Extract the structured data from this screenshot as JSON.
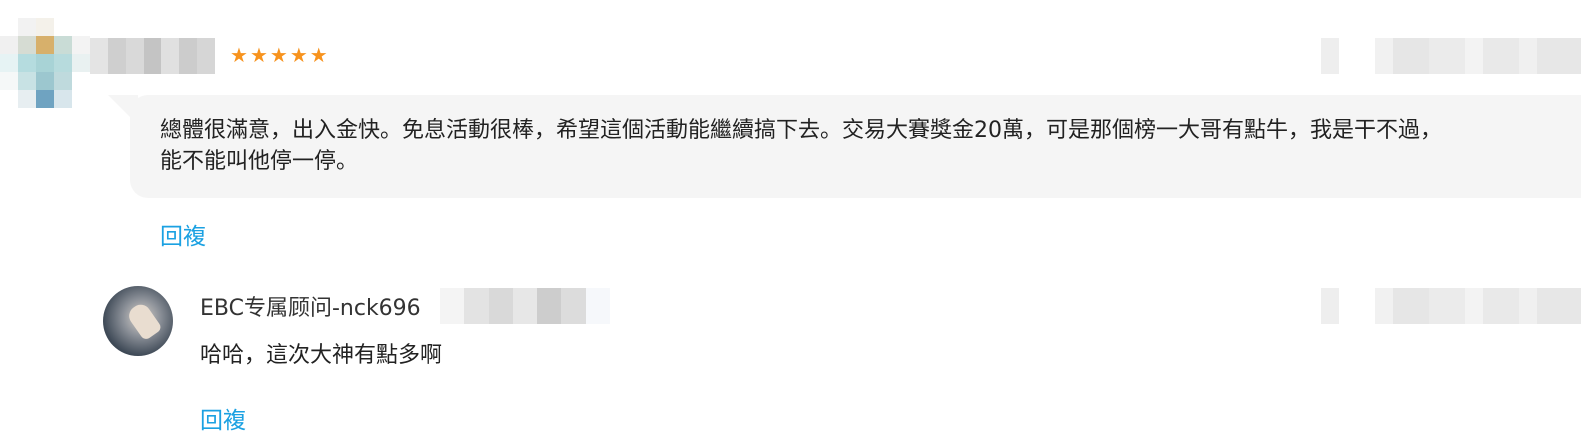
{
  "colors": {
    "star": "#f7931e",
    "link": "#1ba1e2",
    "bubble_bg": "#f5f5f5",
    "text": "#222222"
  },
  "review": {
    "rating": 5,
    "stars": [
      "★",
      "★",
      "★",
      "★",
      "★"
    ],
    "text_line1": "總體很滿意，出入金快。免息活動很棒，希望這個活動能繼續搞下去。交易大賽獎金20萬，可是那個榜一大哥有點牛，我是干不過，",
    "text_line2": "能不能叫他停一停。",
    "reply_label": "回複"
  },
  "reply": {
    "author": "EBC专属顾问-nck696",
    "text": "哈哈，這次大神有點多啊",
    "reply_label": "回複"
  }
}
